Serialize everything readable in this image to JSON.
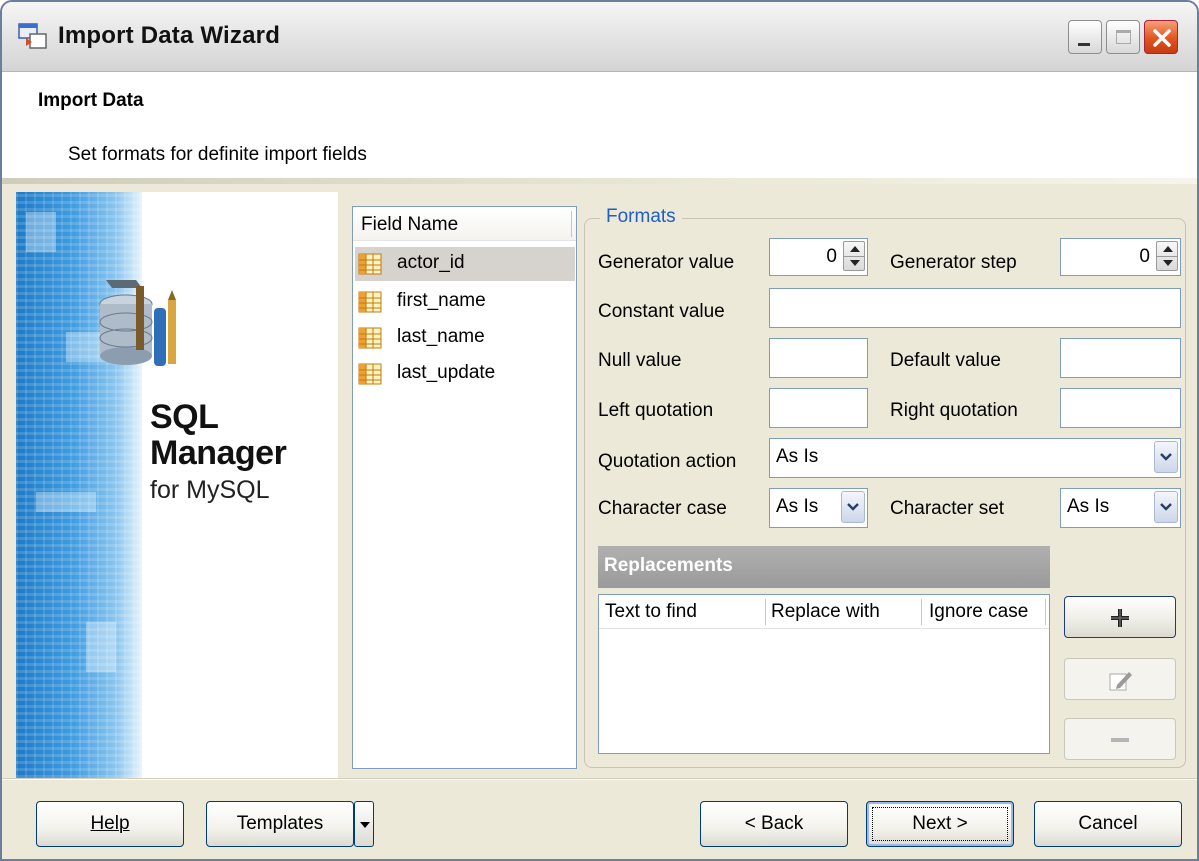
{
  "window": {
    "title": "Import Data Wizard"
  },
  "header": {
    "title": "Import Data",
    "subtitle": "Set formats for definite import fields"
  },
  "banner": {
    "line1": "SQL",
    "line2": "Manager",
    "line3": "for MySQL"
  },
  "field_list": {
    "header": "Field Name",
    "items": [
      {
        "label": "actor_id",
        "selected": true
      },
      {
        "label": "first_name",
        "selected": false
      },
      {
        "label": "last_name",
        "selected": false
      },
      {
        "label": "last_update",
        "selected": false
      }
    ]
  },
  "formats": {
    "legend": "Formats",
    "generator_value_label": "Generator value",
    "generator_value": "0",
    "generator_step_label": "Generator step",
    "generator_step": "0",
    "constant_value_label": "Constant value",
    "constant_value": "",
    "null_value_label": "Null value",
    "null_value": "",
    "default_value_label": "Default value",
    "default_value": "",
    "left_quotation_label": "Left quotation",
    "left_quotation": "",
    "right_quotation_label": "Right quotation",
    "right_quotation": "",
    "quotation_action_label": "Quotation action",
    "quotation_action": "As Is",
    "character_case_label": "Character case",
    "character_case": "As Is",
    "character_set_label": "Character set",
    "character_set": "As Is"
  },
  "replacements": {
    "title": "Replacements",
    "columns": [
      "Text to find",
      "Replace with",
      "Ignore case"
    ],
    "rows": []
  },
  "buttons": {
    "help": "Help",
    "templates": "Templates",
    "back": "< Back",
    "next": "Next >",
    "cancel": "Cancel"
  },
  "colors": {
    "legend_blue": "#1d5fc2",
    "selection": "#d6d3ce",
    "dialog_bg": "#ece9d8"
  }
}
